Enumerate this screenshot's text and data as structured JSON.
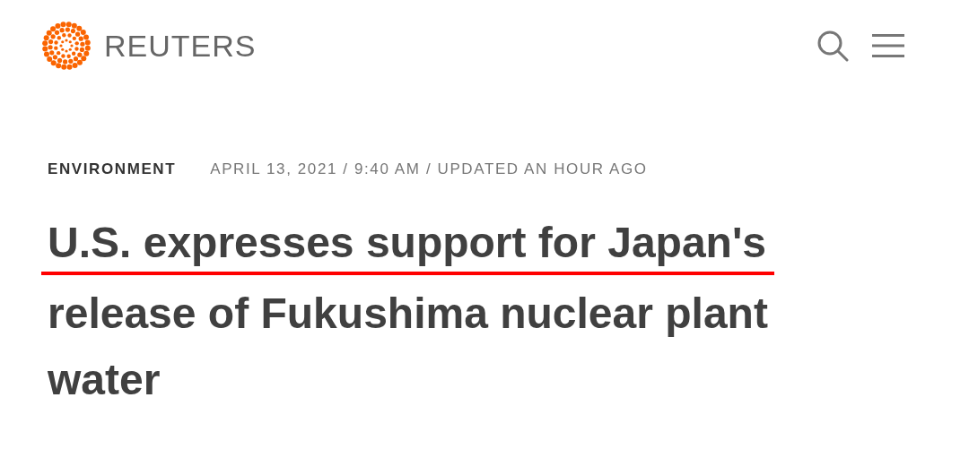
{
  "header": {
    "brand": "REUTERS"
  },
  "meta": {
    "section": "ENVIRONMENT",
    "dateline": "APRIL 13, 2021 / 9:40 AM / UPDATED AN HOUR AGO"
  },
  "headline_lines": [
    {
      "text": "U.S. expresses support for Japan's",
      "underlined": true
    },
    {
      "text": "release of Fukushima nuclear plant",
      "underlined": false
    },
    {
      "text": "water",
      "underlined": false
    }
  ]
}
